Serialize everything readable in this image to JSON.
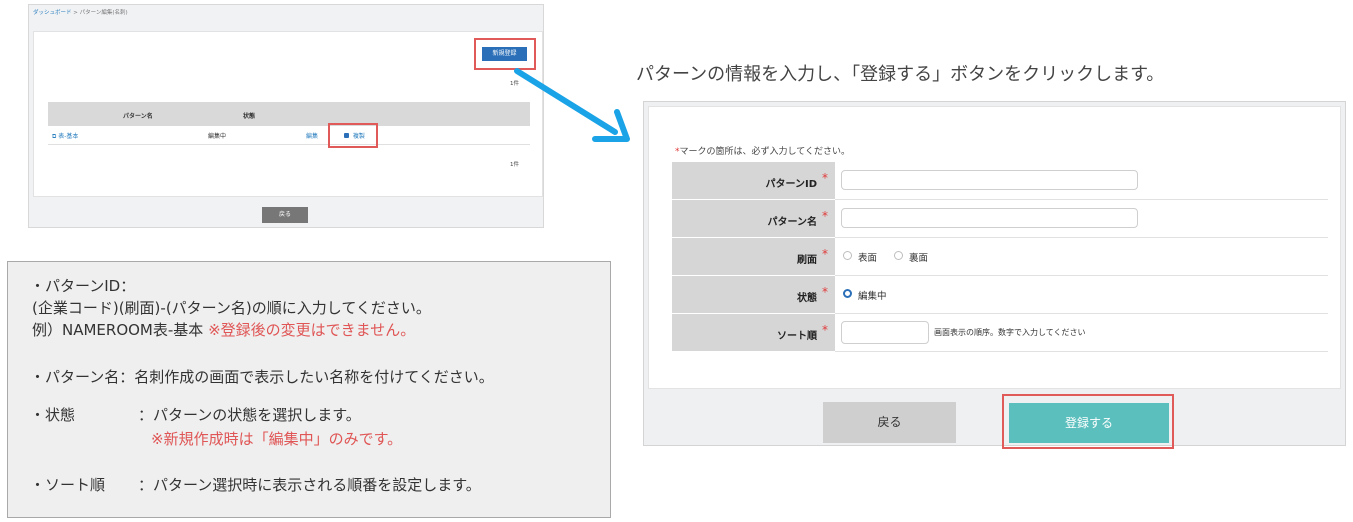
{
  "left_screen": {
    "breadcrumb": {
      "home": "ダッシュボード",
      "sep": ">",
      "current": "パターン編集(名刺)"
    },
    "new_button": "新規登録",
    "count_top": "1件",
    "columns": [
      "パターン名",
      "状態"
    ],
    "row": {
      "name": "表-基本",
      "status": "編集中",
      "edit": "編集",
      "copy": "複製"
    },
    "count_bottom": "1件",
    "back_button": "戻る"
  },
  "info": {
    "l1": "・パターンID：",
    "l2": "(企業コード)(刷面)-(パターン名)の順に入力してください。",
    "l3": "例）NAMEROOM表-基本",
    "l3_note": "※登録後の変更はできません。",
    "l4": "・パターン名：名刺作成の画面で表示したい名称を付けてください。",
    "l5_label": "・状態",
    "l5_text": "：パターンの状態を選択します。",
    "l6_note": "※新規作成時は「編集中」のみです。",
    "l7_label": "・ソート順",
    "l7_text": "：パターン選択時に表示される順番を設定します。"
  },
  "instruction": "パターンの情報を入力し、「登録する」ボタンをクリックします。",
  "form": {
    "required_mark": "*",
    "required_note": "マークの箇所は、必ず入力してください。",
    "fields": {
      "pattern_id": "パターンID",
      "pattern_name": "パターン名",
      "side": "刷面",
      "status": "状態",
      "sort": "ソート順"
    },
    "side_options": [
      "表面",
      "裏面"
    ],
    "status_option": "編集中",
    "sort_hint": "画面表示の順序。数字で入力してください",
    "back_button": "戻る",
    "submit_button": "登録する"
  },
  "colors": {
    "accent_blue": "#2a6fb8",
    "teal": "#5bbfbd",
    "highlight_red": "#e05a5a",
    "arrow": "#1aa3e6"
  }
}
